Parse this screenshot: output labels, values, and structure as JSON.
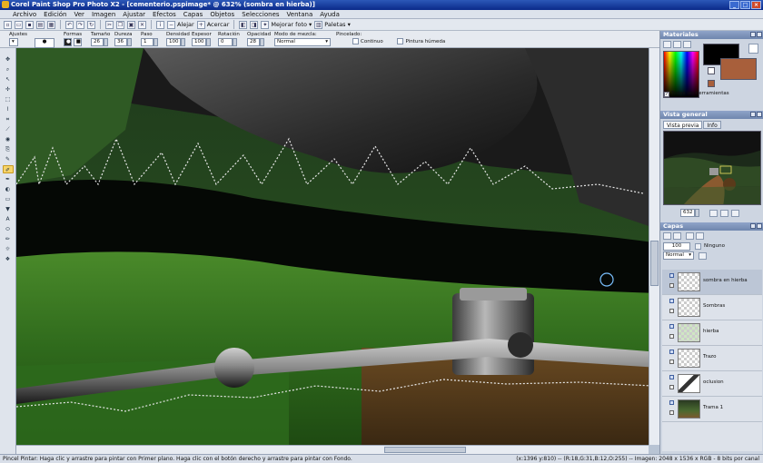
{
  "window": {
    "title": "Corel Paint Shop Pro Photo X2 - [cementerio.pspimage* @ 632% (sombra en hierba)]"
  },
  "menu": [
    "Archivo",
    "Edición",
    "Ver",
    "Imagen",
    "Ajustar",
    "Efectos",
    "Capas",
    "Objetos",
    "Selecciones",
    "Ventana",
    "Ayuda"
  ],
  "toolbar": {
    "alejar": "Alejar",
    "acercar": "Acercar",
    "mejorar": "Mejorar foto",
    "paletas": "Paletas"
  },
  "tool_options": {
    "preset_label": "Ajustes",
    "shape": {
      "label": "Formas"
    },
    "size": {
      "label": "Tamaño",
      "value": "26"
    },
    "hardness": {
      "label": "Dureza",
      "value": "36"
    },
    "step": {
      "label": "Paso",
      "value": "1"
    },
    "density": {
      "label": "Densidad",
      "value": "100"
    },
    "thickness": {
      "label": "Espesor",
      "value": "100"
    },
    "rotation": {
      "label": "Rotación",
      "value": "0"
    },
    "opacity": {
      "label": "Opacidad",
      "value": "28"
    },
    "blend": {
      "label": "Modo de mezcla:",
      "value": "Normal"
    },
    "stroke": {
      "label": "Pincelado:",
      "continuous": "Continuo",
      "wet": "Pintura húmeda"
    }
  },
  "materials": {
    "title": "Materiales",
    "all_tools": "Todas las herramientas",
    "fg_color": "#000000",
    "bg_color": "#a85f3b"
  },
  "overview": {
    "title": "Vista general",
    "tab_preview": "Vista previa",
    "tab_info": "Info",
    "zoom": "632"
  },
  "layers_panel": {
    "title": "Capas",
    "opacity": "100",
    "mask_mode": "Ninguno",
    "blend": "Normal",
    "layers": [
      {
        "name": "sombra en hierba",
        "selected": true
      },
      {
        "name": "Sombras",
        "selected": false
      },
      {
        "name": "hierba",
        "selected": false
      },
      {
        "name": "Trazo",
        "selected": false
      },
      {
        "name": "oclusion",
        "selected": false
      },
      {
        "name": "Trama 1",
        "selected": false
      }
    ]
  },
  "status": {
    "message": "Pincel Pintar: Haga clic y arrastre para pintar con Primer plano. Haga clic con el botón derecho y arrastre para pintar con Fondo.",
    "info": "(x:1396 y:810) -- (R:18,G:31,B:12,O:255) -- Imagen: 2048 x 1536 x RGB - 8 bits por canal"
  }
}
